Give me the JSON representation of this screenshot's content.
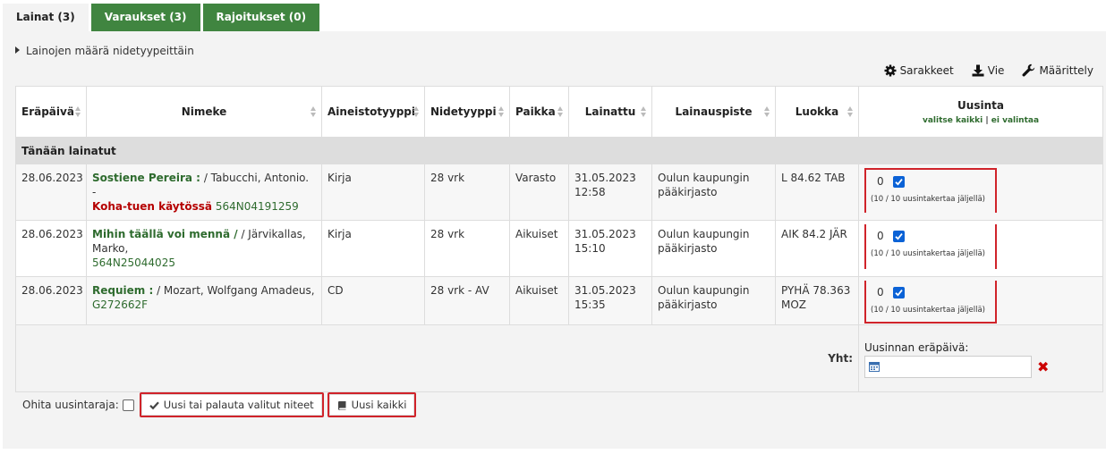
{
  "tabs": [
    {
      "label": "Lainat (3)",
      "active": true
    },
    {
      "label": "Varaukset (3)",
      "active": false
    },
    {
      "label": "Rajoitukset (0)",
      "active": false
    }
  ],
  "toggle_label": "Lainojen määrä nidetyypeittäin",
  "toolbar": {
    "columns": "Sarakkeet",
    "export": "Vie",
    "configure": "Määrittely"
  },
  "table": {
    "headers": {
      "due": "Eräpäivä",
      "title": "Nimeke",
      "itemtype": "Aineistotyyppi",
      "loantype": "Nidetyyppi",
      "location": "Paikka",
      "checkedout": "Lainattu",
      "library": "Lainauspiste",
      "callnumber": "Luokka",
      "renew": "Uusinta",
      "select_all": "valitse kaikki",
      "separator": "|",
      "select_none": "ei valintaa"
    },
    "group_label": "Tänään lainatut",
    "rows": [
      {
        "due": "28.06.2023",
        "title": "Sostiene Pereira :",
        "author": "/ Tabucchi, Antonio. -",
        "warning": "Koha-tuen käytössä",
        "barcode": "564N04191259",
        "itemtype": "Kirja",
        "loantype": "28 vrk",
        "location": "Varasto",
        "date": "31.05.2023",
        "time": "12:58",
        "library": "Oulun kaupungin pääkirjasto",
        "callnumber": "L 84.62 TAB",
        "renew_count": "0",
        "renew_info": "(10 / 10 uusintakertaa jäljellä)"
      },
      {
        "due": "28.06.2023",
        "title": "Mihin täällä voi mennä /",
        "author": "/ Järvikallas, Marko,",
        "barcode": "564N25044025",
        "itemtype": "Kirja",
        "loantype": "28 vrk",
        "location": "Aikuiset",
        "date": "31.05.2023",
        "time": "15:10",
        "library": "Oulun kaupungin pääkirjasto",
        "callnumber": "AIK 84.2 JÄR",
        "renew_count": "0",
        "renew_info": "(10 / 10 uusintakertaa jäljellä)"
      },
      {
        "due": "28.06.2023",
        "title": "Requiem :",
        "author": "/ Mozart, Wolfgang Amadeus,",
        "barcode": "G272662F",
        "itemtype": "CD",
        "loantype": "28 vrk - AV",
        "location": "Aikuiset",
        "date": "31.05.2023",
        "time": "15:35",
        "library": "Oulun kaupungin pääkirjasto",
        "callnumber": "PYHÄ 78.363 MOZ",
        "renew_count": "0",
        "renew_info": "(10 / 10 uusintakertaa jäljellä)"
      }
    ],
    "footer": {
      "total_label": "Yht:",
      "due_label": "Uusinnan eräpäivä:"
    }
  },
  "actions": {
    "override_label": "Ohita uusintaraja:",
    "renew_checkin": "Uusi tai palauta valitut niteet",
    "renew_all": "Uusi kaikki"
  },
  "colors": {
    "accent": "#408540",
    "highlight": "#d0232a",
    "link": "#2e6b2e",
    "warning": "#b50000"
  }
}
